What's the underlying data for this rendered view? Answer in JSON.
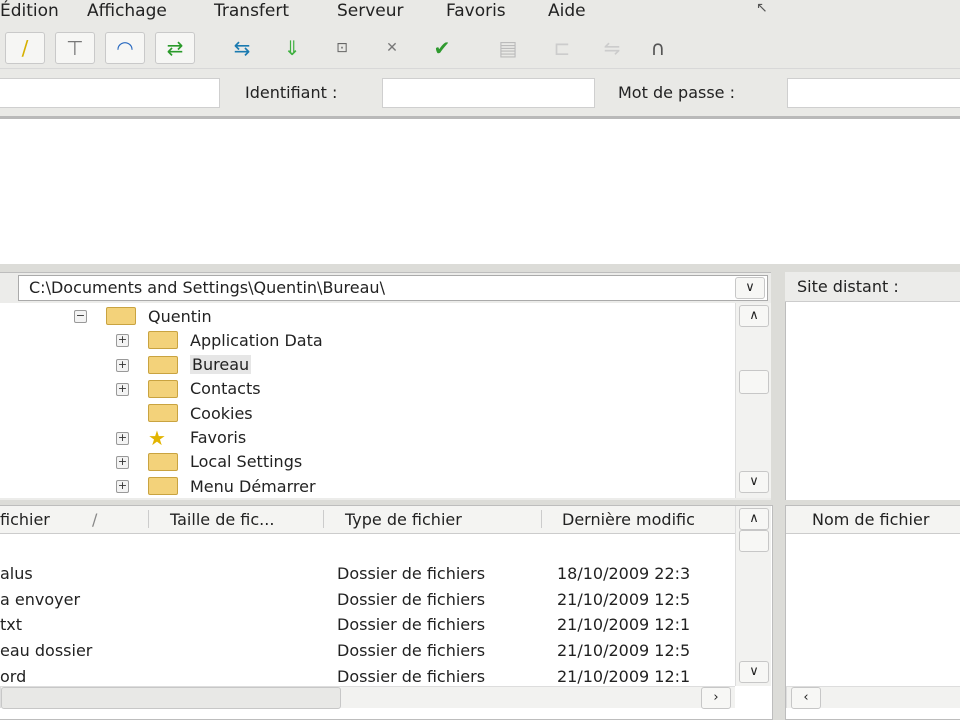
{
  "menu": [
    "Édition",
    "Affichage",
    "Transfert",
    "Serveur",
    "Favoris",
    "Aide"
  ],
  "quickconnect": {
    "host_value": "",
    "user_label": "Identifiant :",
    "user_value": "",
    "pass_label": "Mot de passe :",
    "pass_value": ""
  },
  "local": {
    "path": "C:\\Documents and Settings\\Quentin\\Bureau\\",
    "tree": [
      {
        "label": "Quentin",
        "expanded": true
      },
      {
        "label": "Application Data"
      },
      {
        "label": "Bureau",
        "selected": true
      },
      {
        "label": "Contacts"
      },
      {
        "label": "Cookies"
      },
      {
        "label": "Favoris"
      },
      {
        "label": "Local Settings"
      },
      {
        "label": "Menu Démarrer"
      }
    ],
    "columns": [
      "fichier",
      "/",
      "Taille de fic...",
      "Type de fichier",
      "Dernière modific"
    ],
    "rows": [
      {
        "name": "..",
        "type": "",
        "date": ""
      },
      {
        "name": "alus",
        "type": "Dossier de fichiers",
        "date": "18/10/2009 22:3"
      },
      {
        "name": "a envoyer",
        "type": "Dossier de fichiers",
        "date": "21/10/2009 12:5"
      },
      {
        "name": "txt",
        "type": "Dossier de fichiers",
        "date": "21/10/2009 12:1"
      },
      {
        "name": "eau dossier",
        "type": "Dossier de fichiers",
        "date": "21/10/2009 12:5"
      },
      {
        "name": "ord",
        "type": "Dossier de fichiers",
        "date": "21/10/2009 12:1"
      }
    ]
  },
  "remote": {
    "site_label": "Site distant :",
    "column": "Nom de fichier"
  }
}
